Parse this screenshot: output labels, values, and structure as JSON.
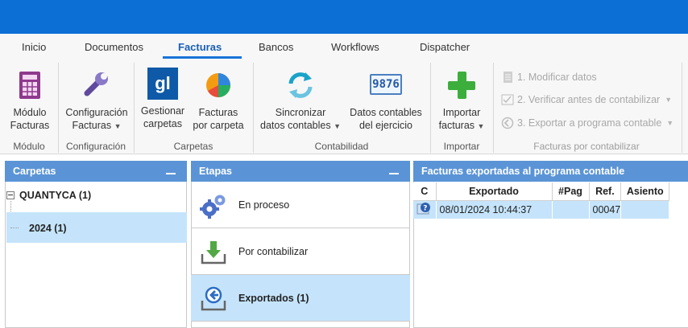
{
  "tabs": [
    {
      "label": "Inicio"
    },
    {
      "label": "Documentos"
    },
    {
      "label": "Facturas"
    },
    {
      "label": "Bancos"
    },
    {
      "label": "Workflows"
    },
    {
      "label": "Dispatcher"
    }
  ],
  "ribbon": {
    "modulo": {
      "line1": "Módulo",
      "line2": "Facturas",
      "group": "Módulo"
    },
    "configuracion": {
      "line1": "Configuración",
      "line2": "Facturas",
      "group": "Configuración"
    },
    "gestionar": {
      "line1": "Gestionar",
      "line2": "carpetas",
      "icon_text": "gl"
    },
    "porcarpeta": {
      "line1": "Facturas",
      "line2": "por carpeta"
    },
    "carpetas_group": "Carpetas",
    "sincronizar": {
      "line1": "Sincronizar",
      "line2": "datos contables"
    },
    "datos": {
      "line1": "Datos contables",
      "line2": "del ejercicio",
      "icon_text": "9876"
    },
    "contabilidad_group": "Contabilidad",
    "importar": {
      "line1": "Importar",
      "line2": "facturas",
      "group": "Importar"
    },
    "pendientes": {
      "modificar": "1. Modificar datos",
      "verificar": "2. Verificar antes de contabilizar",
      "exportar": "3. Exportar a programa contable",
      "group": "Facturas por contabilizar"
    }
  },
  "carpetas": {
    "title": "Carpetas",
    "root": "QUANTYCA (1)",
    "child": "2024  (1)"
  },
  "etapas": {
    "title": "Etapas",
    "items": [
      {
        "label": "En proceso"
      },
      {
        "label": "Por contabilizar"
      },
      {
        "label": "Exportados (1)"
      }
    ]
  },
  "facturas": {
    "title": "Facturas exportadas al programa contable",
    "columns": [
      "C",
      "Exportado",
      "#Pag",
      "Ref.",
      "Asiento"
    ],
    "rows": [
      {
        "exportado": "08/01/2024 10:44:37",
        "pag": "",
        "ref": "00047",
        "asiento": ""
      }
    ]
  }
}
